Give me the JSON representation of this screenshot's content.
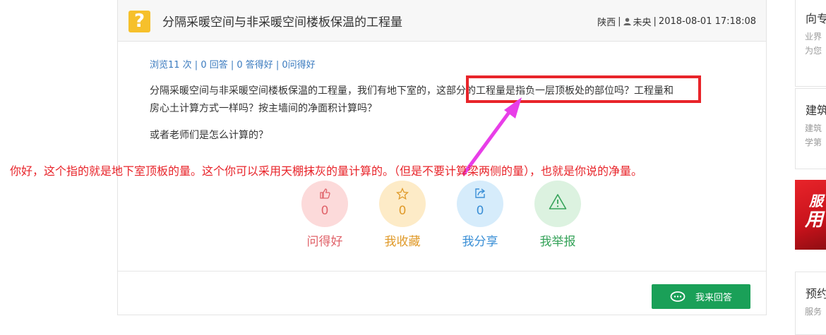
{
  "question": {
    "icon": "question-mark-icon",
    "icon_glyph": "?",
    "title": "分隔采暖空间与非采暖空间楼板保温的工程量",
    "location": "陕西",
    "separator": "|",
    "user": "未央",
    "datetime": "2018-08-01 17:18:08",
    "stats": "浏览11 次 | 0 回答 | 0 答得好 | 0问得好",
    "body_line1_part1": "分隔采暖空间与非采暖空间楼板保温的工程量，我们有地下室的，",
    "body_line1_highlight": "这部分的工程量是指负一层顶板处的部位吗？",
    "body_line1_part2": "工程量和",
    "body_line2": "房心土计算方式一样吗？按主墙间的净面积计算吗？",
    "body_para2": "或者老师们是怎么计算的？"
  },
  "annotation": {
    "answer_text": "你好，这个指的就是地下室顶板的量。这个你可以采用天棚抹灰的量计算的。（但是不要计算梁两侧的量），也就是你说的净量。",
    "color": "#e8242a",
    "arrow_color": "#e83ee8"
  },
  "actions": [
    {
      "name": "good-question",
      "icon": "thumbs-up-icon",
      "glyph": "👍",
      "count": "0",
      "label": "问得好",
      "bg": "#fcdada",
      "fg": "#e0636a"
    },
    {
      "name": "favorite",
      "icon": "star-icon",
      "glyph": "☆",
      "count": "0",
      "label": "我收藏",
      "bg": "#fdebc7",
      "fg": "#e09a2a"
    },
    {
      "name": "share",
      "icon": "share-icon",
      "glyph": "⇗",
      "count": "0",
      "label": "我分享",
      "bg": "#d6ecfb",
      "fg": "#3a8fd6"
    },
    {
      "name": "report",
      "icon": "warning-icon",
      "glyph": "⚠",
      "count": "",
      "label": "我举报",
      "bg": "#dcf2e0",
      "fg": "#36a35a"
    }
  ],
  "answer_button": {
    "label": "我来回答",
    "icon": "chat-bubble-icon",
    "bg": "#1aa058"
  },
  "sidebar": {
    "box1_title": "向专",
    "box1_desc1": "业界",
    "box1_desc2": "为您",
    "box2_title": "建筑",
    "box2_desc1": "建筑",
    "box2_desc2": "学第",
    "ad_text1": "服",
    "ad_text2": "用",
    "box3_title": "预约",
    "box3_desc1": "服务"
  }
}
